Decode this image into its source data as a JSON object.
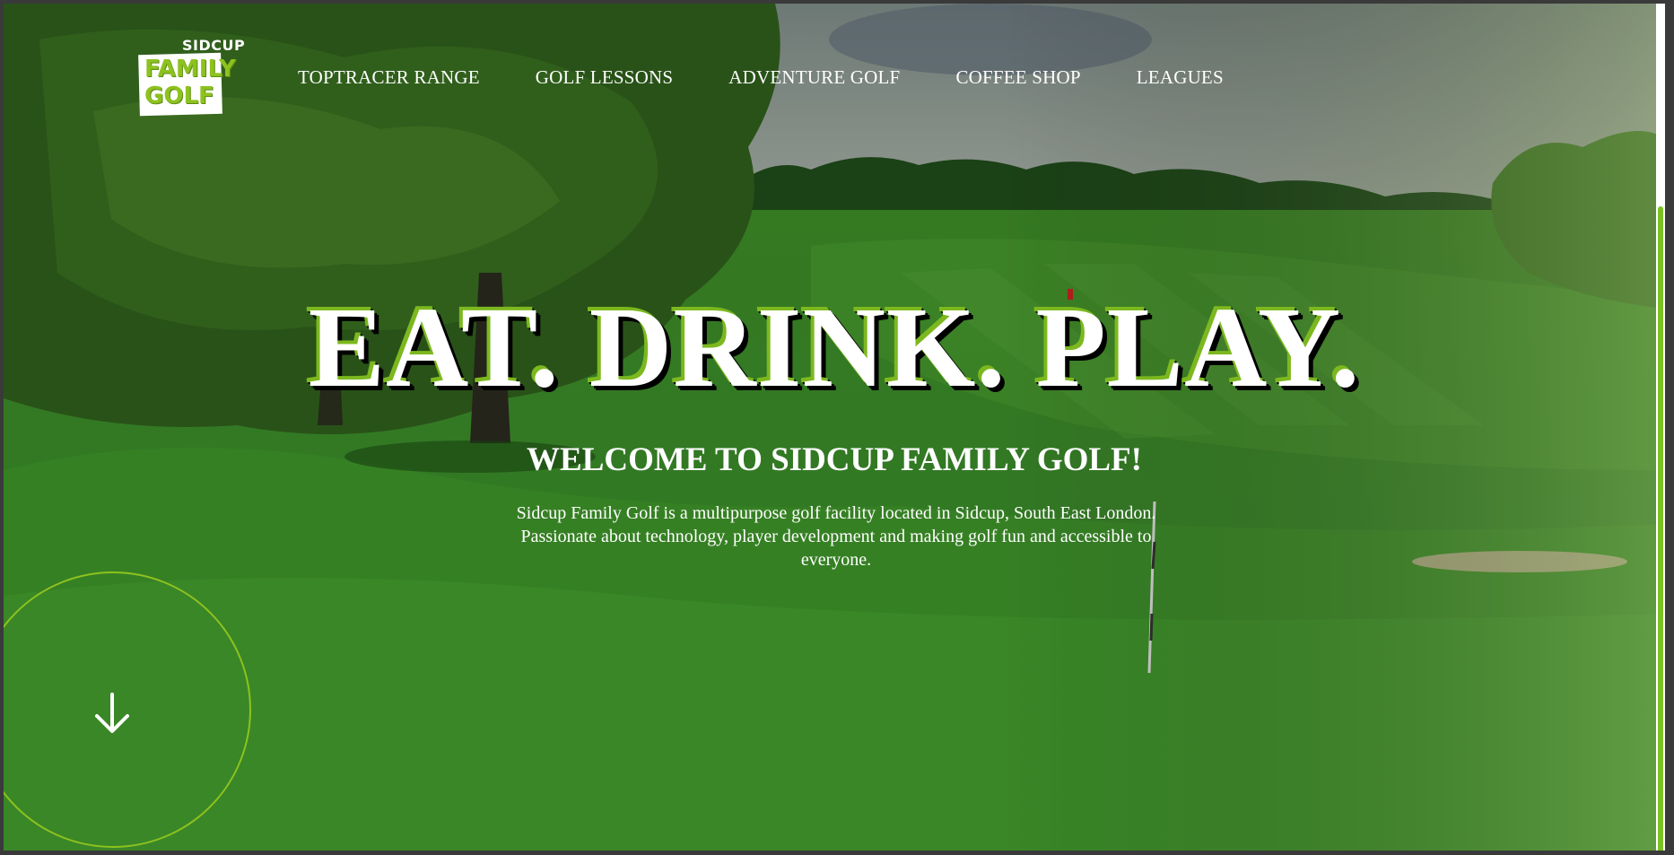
{
  "logo": {
    "top_word": "SIDCUP",
    "line1": "FAMILY",
    "line2": "GOLF"
  },
  "nav": {
    "items": [
      {
        "label": "TOPTRACER RANGE"
      },
      {
        "label": "GOLF LESSONS"
      },
      {
        "label": "ADVENTURE GOLF"
      },
      {
        "label": "COFFEE SHOP"
      },
      {
        "label": "LEAGUES"
      }
    ]
  },
  "hero": {
    "title": "EAT. DRINK. PLAY.",
    "subtitle": "WELCOME TO SIDCUP FAMILY GOLF!",
    "text": "Sidcup Family Golf is a multipurpose golf facility located in Sidcup, South East London. Passionate about technology, player development and making golf fun and accessible to everyone."
  },
  "scroll": {
    "icon": "arrow-down-icon"
  },
  "colors": {
    "accent": "#8dc21f",
    "text": "#ffffff",
    "scrollbar_thumb": "#7cc122"
  }
}
